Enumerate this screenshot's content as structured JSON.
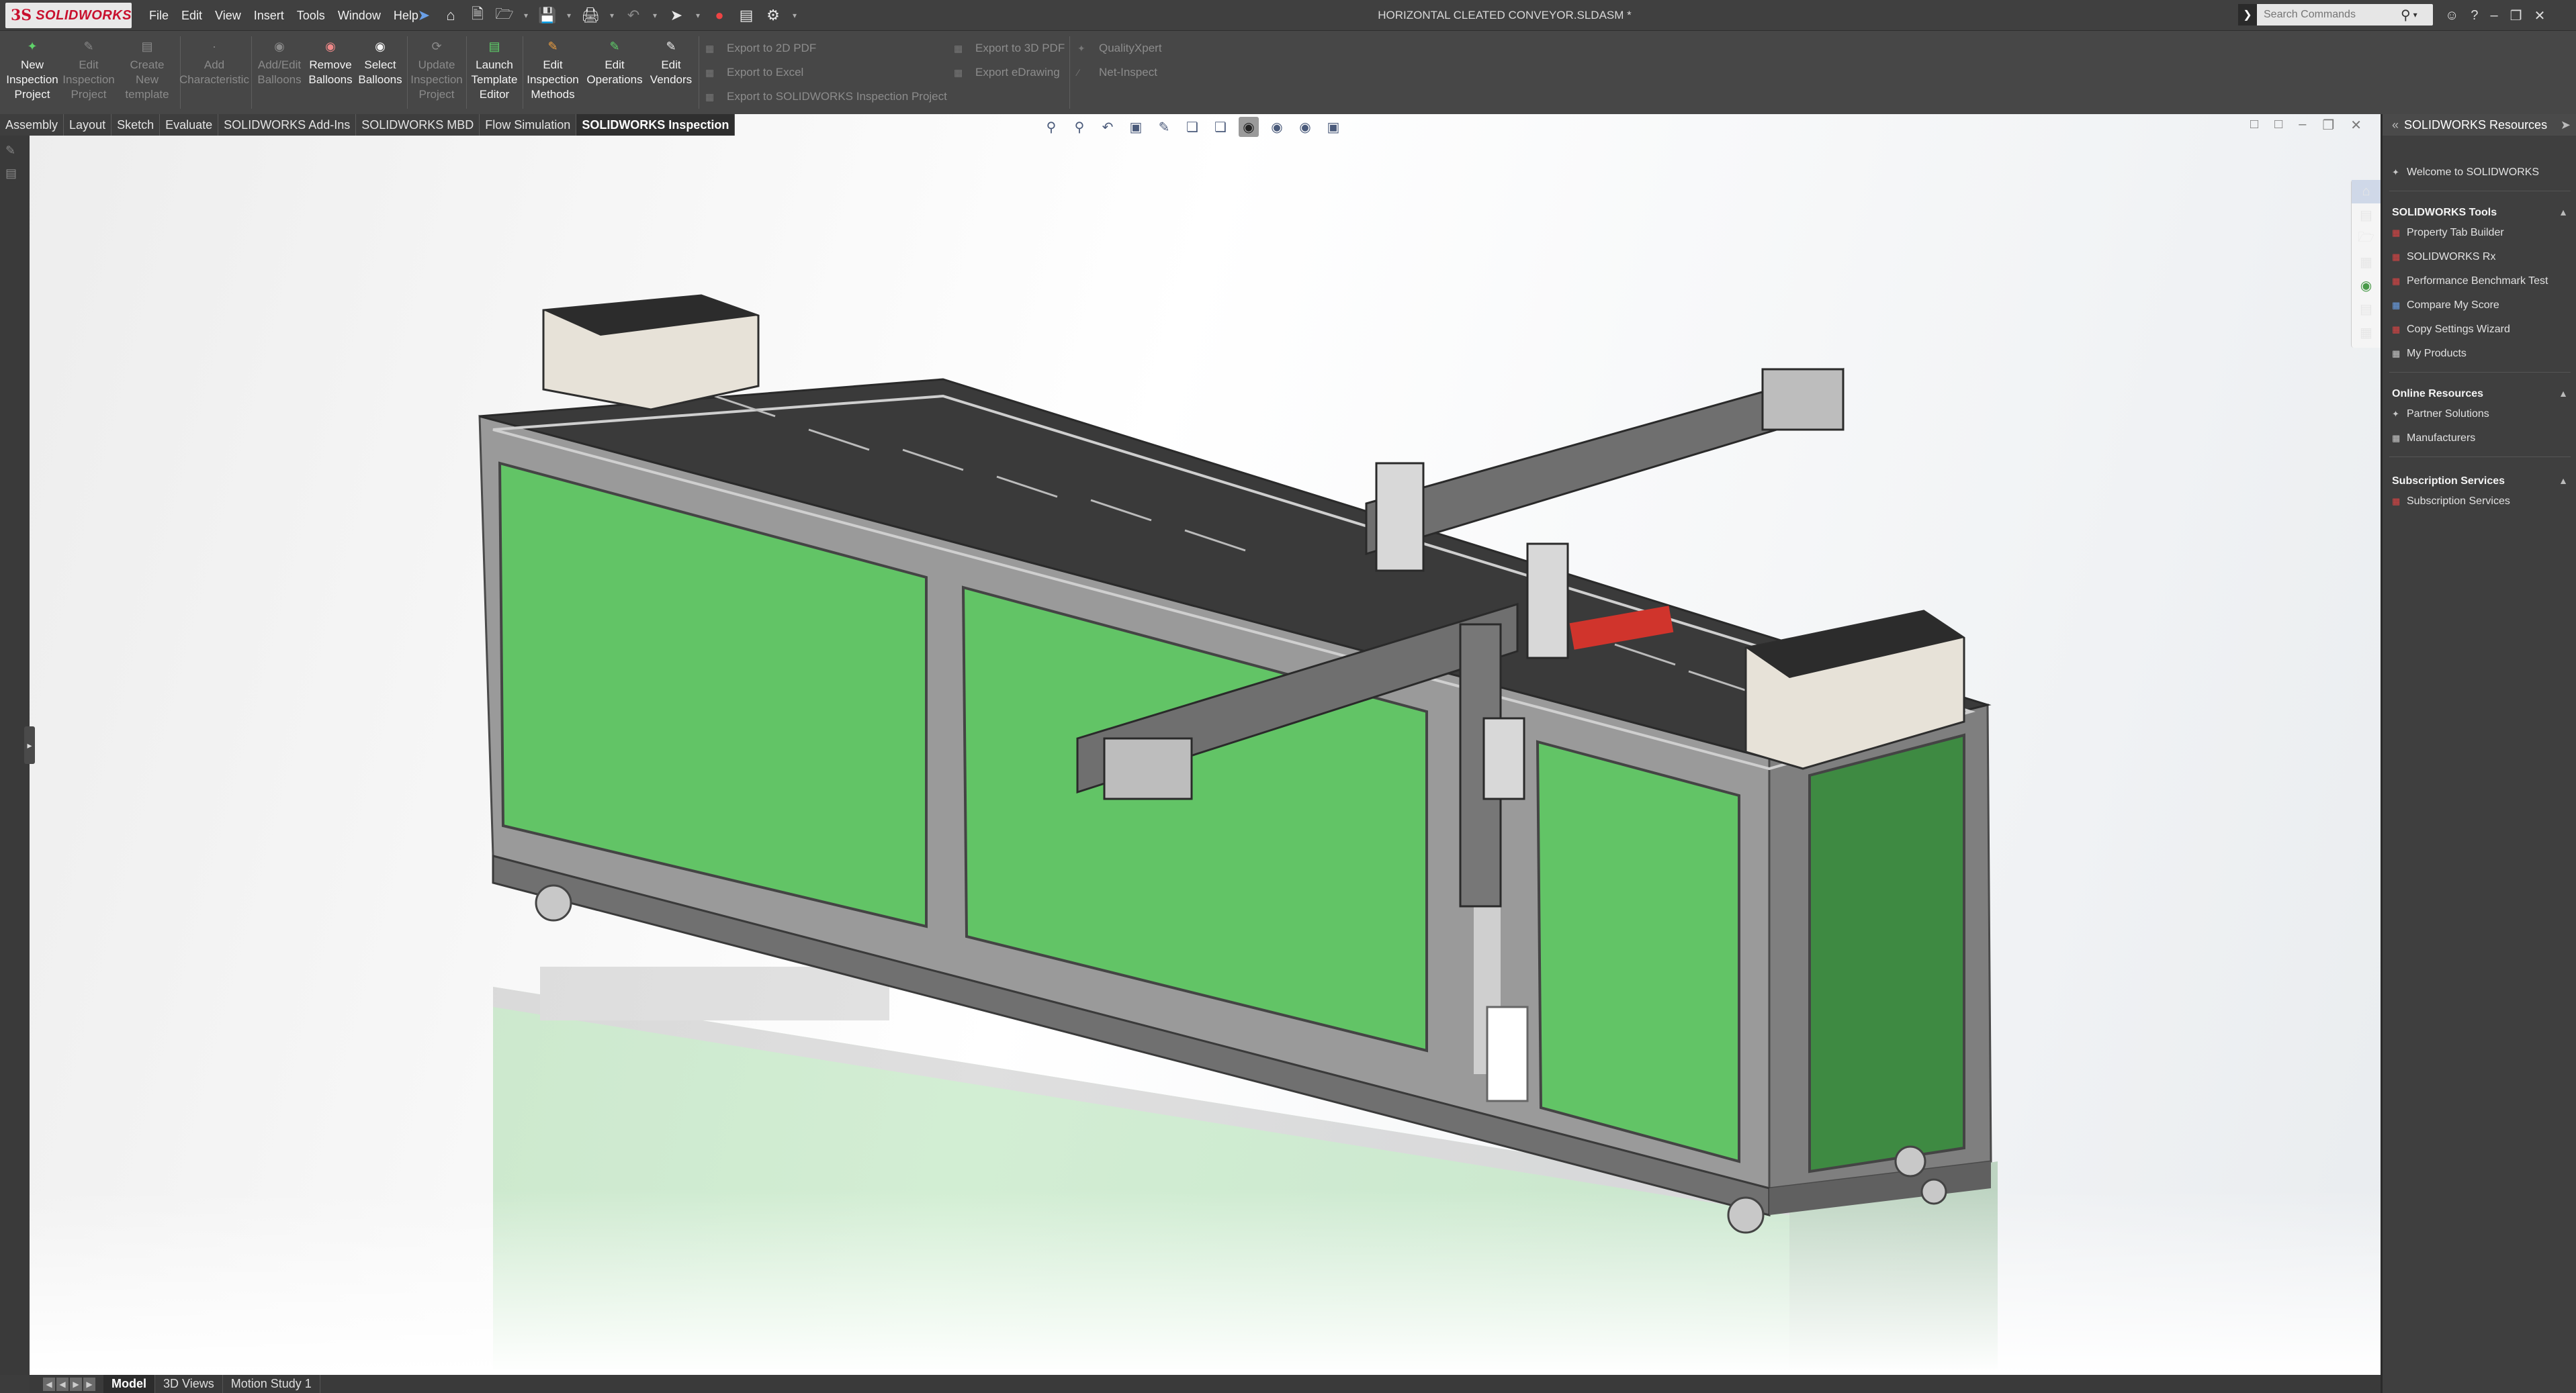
{
  "app": {
    "logo_mark": "3S",
    "logo_text": "SOLIDWORKS",
    "document_title": "HORIZONTAL CLEATED CONVEYOR.SLDASM *"
  },
  "menu": [
    "File",
    "Edit",
    "View",
    "Insert",
    "Tools",
    "Window",
    "Help"
  ],
  "search": {
    "placeholder": "Search Commands"
  },
  "commands": {
    "new_inspection_project": [
      "New",
      "Inspection",
      "Project"
    ],
    "edit_inspection_project": [
      "Edit",
      "Inspection",
      "Project"
    ],
    "create_new_template": [
      "Create",
      "New",
      "template"
    ],
    "add_characteristic": [
      "Add",
      "Characteristic"
    ],
    "add_edit_balloons": [
      "Add/Edit",
      "Balloons"
    ],
    "remove_balloons": [
      "Remove",
      "Balloons"
    ],
    "select_balloons": [
      "Select",
      "Balloons"
    ],
    "update_inspection_project": [
      "Update",
      "Inspection",
      "Project"
    ],
    "launch_template_editor": [
      "Launch",
      "Template",
      "Editor"
    ],
    "edit_inspection_methods": [
      "Edit",
      "Inspection",
      "Methods"
    ],
    "edit_operations": [
      "Edit",
      "Operations"
    ],
    "edit_vendors": [
      "Edit",
      "Vendors"
    ],
    "export_2d_pdf": "Export to 2D PDF",
    "export_excel": "Export to Excel",
    "export_sw_inspection": "Export to SOLIDWORKS Inspection Project",
    "export_3d_pdf": "Export to 3D PDF",
    "export_edrawing": "Export eDrawing",
    "qualityxpert": "QualityXpert",
    "net_inspect": "Net-Inspect"
  },
  "tabs": [
    "Assembly",
    "Layout",
    "Sketch",
    "Evaluate",
    "SOLIDWORKS Add-Ins",
    "SOLIDWORKS MBD",
    "Flow Simulation",
    "SOLIDWORKS Inspection"
  ],
  "active_tab": "SOLIDWORKS Inspection",
  "task_pane": {
    "title": "SOLIDWORKS Resources",
    "welcome": "Welcome to SOLIDWORKS",
    "tools_header": "SOLIDWORKS Tools",
    "tools": [
      "Property Tab Builder",
      "SOLIDWORKS Rx",
      "Performance Benchmark Test",
      "Compare My Score",
      "Copy Settings Wizard",
      "My Products"
    ],
    "online_header": "Online Resources",
    "online": [
      "Partner Solutions",
      "Manufacturers"
    ],
    "subscription_header": "Subscription Services",
    "subscription": [
      "Subscription Services"
    ]
  },
  "bottom_tabs": [
    "Model",
    "3D Views",
    "Motion Study 1"
  ],
  "active_bottom_tab": "Model",
  "colors": {
    "brand_red": "#c8102e",
    "panel_green": "#62c466",
    "frame_gray": "#8e8e8e",
    "housing_beige": "#e7e2d8"
  }
}
